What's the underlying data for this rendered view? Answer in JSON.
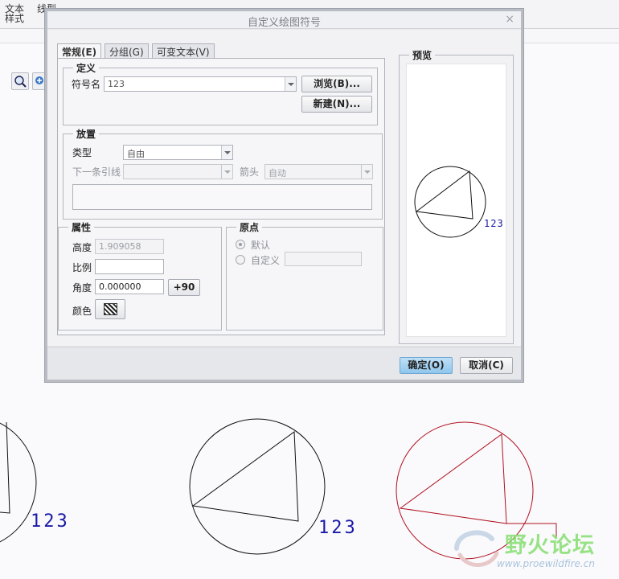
{
  "app": {
    "ribbon_text_style_1": "文本",
    "ribbon_text_style_2": "样式",
    "ribbon_line_type": "线型"
  },
  "dialog": {
    "title": "自定义绘图符号",
    "close_glyph": "×",
    "tabs": [
      {
        "label": "常规(E)",
        "active": true
      },
      {
        "label": "分组(G)",
        "active": false
      },
      {
        "label": "可变文本(V)",
        "active": false
      }
    ],
    "definition": {
      "group_title": "定义",
      "symbol_name_label": "符号名",
      "symbol_name_value": "123",
      "browse_button": "浏览(B)...",
      "new_button": "新建(N)..."
    },
    "placement": {
      "group_title": "放置",
      "type_label": "类型",
      "type_value": "自由",
      "next_leader_label": "下一条引线",
      "next_leader_value": "",
      "arrow_label": "箭头",
      "arrow_value": "自动"
    },
    "attributes": {
      "group_title": "属性",
      "height_label": "高度",
      "height_value": "1.909058",
      "scale_label": "比例",
      "scale_value": "",
      "angle_label": "角度",
      "angle_value": "0.000000",
      "rotate_button": "+90",
      "color_label": "颜色"
    },
    "origin": {
      "group_title": "原点",
      "default_label": "默认",
      "custom_label": "自定义",
      "custom_value": "",
      "default_checked": true
    },
    "preview": {
      "group_title": "预览",
      "symbol_text": "123"
    },
    "ok_button": "确定(O)",
    "cancel_button": "取消(C)"
  },
  "drawing": {
    "symbol_label_left": "123",
    "symbol_label_middle": "123",
    "colors": {
      "symbol_line": "#111111",
      "symbol_text": "#1a1aa8",
      "selected_symbol": "#b01020"
    }
  },
  "watermark": {
    "text": "野火论坛",
    "url": "www.proewildfire.cn"
  }
}
